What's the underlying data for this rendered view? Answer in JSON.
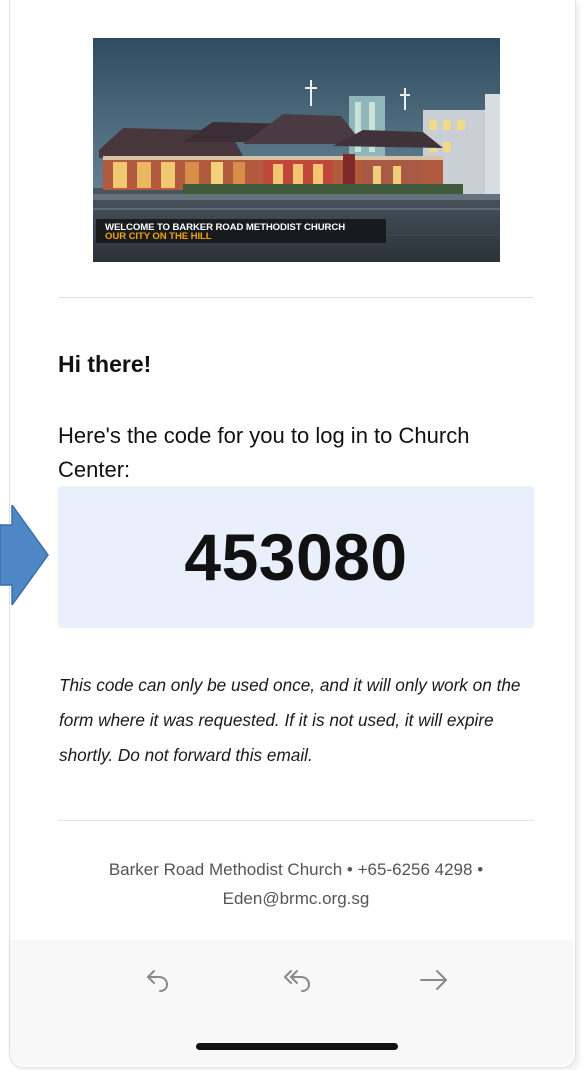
{
  "header": {
    "banner_line_1": "WELCOME TO BARKER ROAD METHODIST CHURCH",
    "banner_line_2": "OUR CITY ON THE HILL"
  },
  "email": {
    "greeting": "Hi there!",
    "intro": "Here's the code for you to log in to Church Center:",
    "login_code": "453080",
    "notice": "This code can only be used once, and it will only work on the form where it was requested. If it is not used, it will expire shortly. Do not forward this email."
  },
  "footer": {
    "contact": "Barker Road Methodist Church • +65-6256 4298 • Eden@brmc.org.sg"
  },
  "toolbar": {
    "icons": [
      "reply-icon",
      "reply-all-icon",
      "forward-icon"
    ]
  },
  "colors": {
    "code_box_background": "#e9f0fc",
    "pointer_arrow": "#4f86c6",
    "banner_accent": "#f2a20e"
  }
}
